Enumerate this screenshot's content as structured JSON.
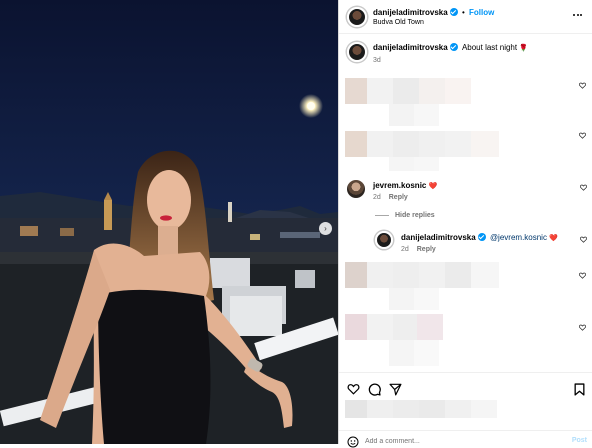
{
  "header": {
    "username": "danijeladimitrovska",
    "separator": "•",
    "follow_label": "Follow",
    "location": "Budva Old Town",
    "more_icon": "more-horizontal-icon"
  },
  "caption": {
    "username": "danijeladimitrovska",
    "text": "About last night",
    "emoji": "🌹",
    "time": "3d"
  },
  "comments": [
    {
      "username": "jevrem.kosnic",
      "text": "❤️",
      "time": "2d",
      "reply_label": "Reply"
    }
  ],
  "hide_replies_label": "Hide replies",
  "reply": {
    "username": "danijeladimitrovska",
    "mention": "@jevrem.kosnic",
    "text": "❤️",
    "time": "2d",
    "reply_label": "Reply"
  },
  "actions": {
    "like_icon": "heart-icon",
    "comment_icon": "comment-icon",
    "share_icon": "send-icon",
    "save_icon": "bookmark-icon"
  },
  "add_comment": {
    "placeholder": "Add a comment...",
    "post_label": "Post"
  },
  "media": {
    "next_icon": "chevron-right-icon"
  },
  "colors": {
    "verified": "#0095f6",
    "follow": "#0095f6",
    "heart_red": "#ed1c3b",
    "sky": "#0c1630"
  }
}
